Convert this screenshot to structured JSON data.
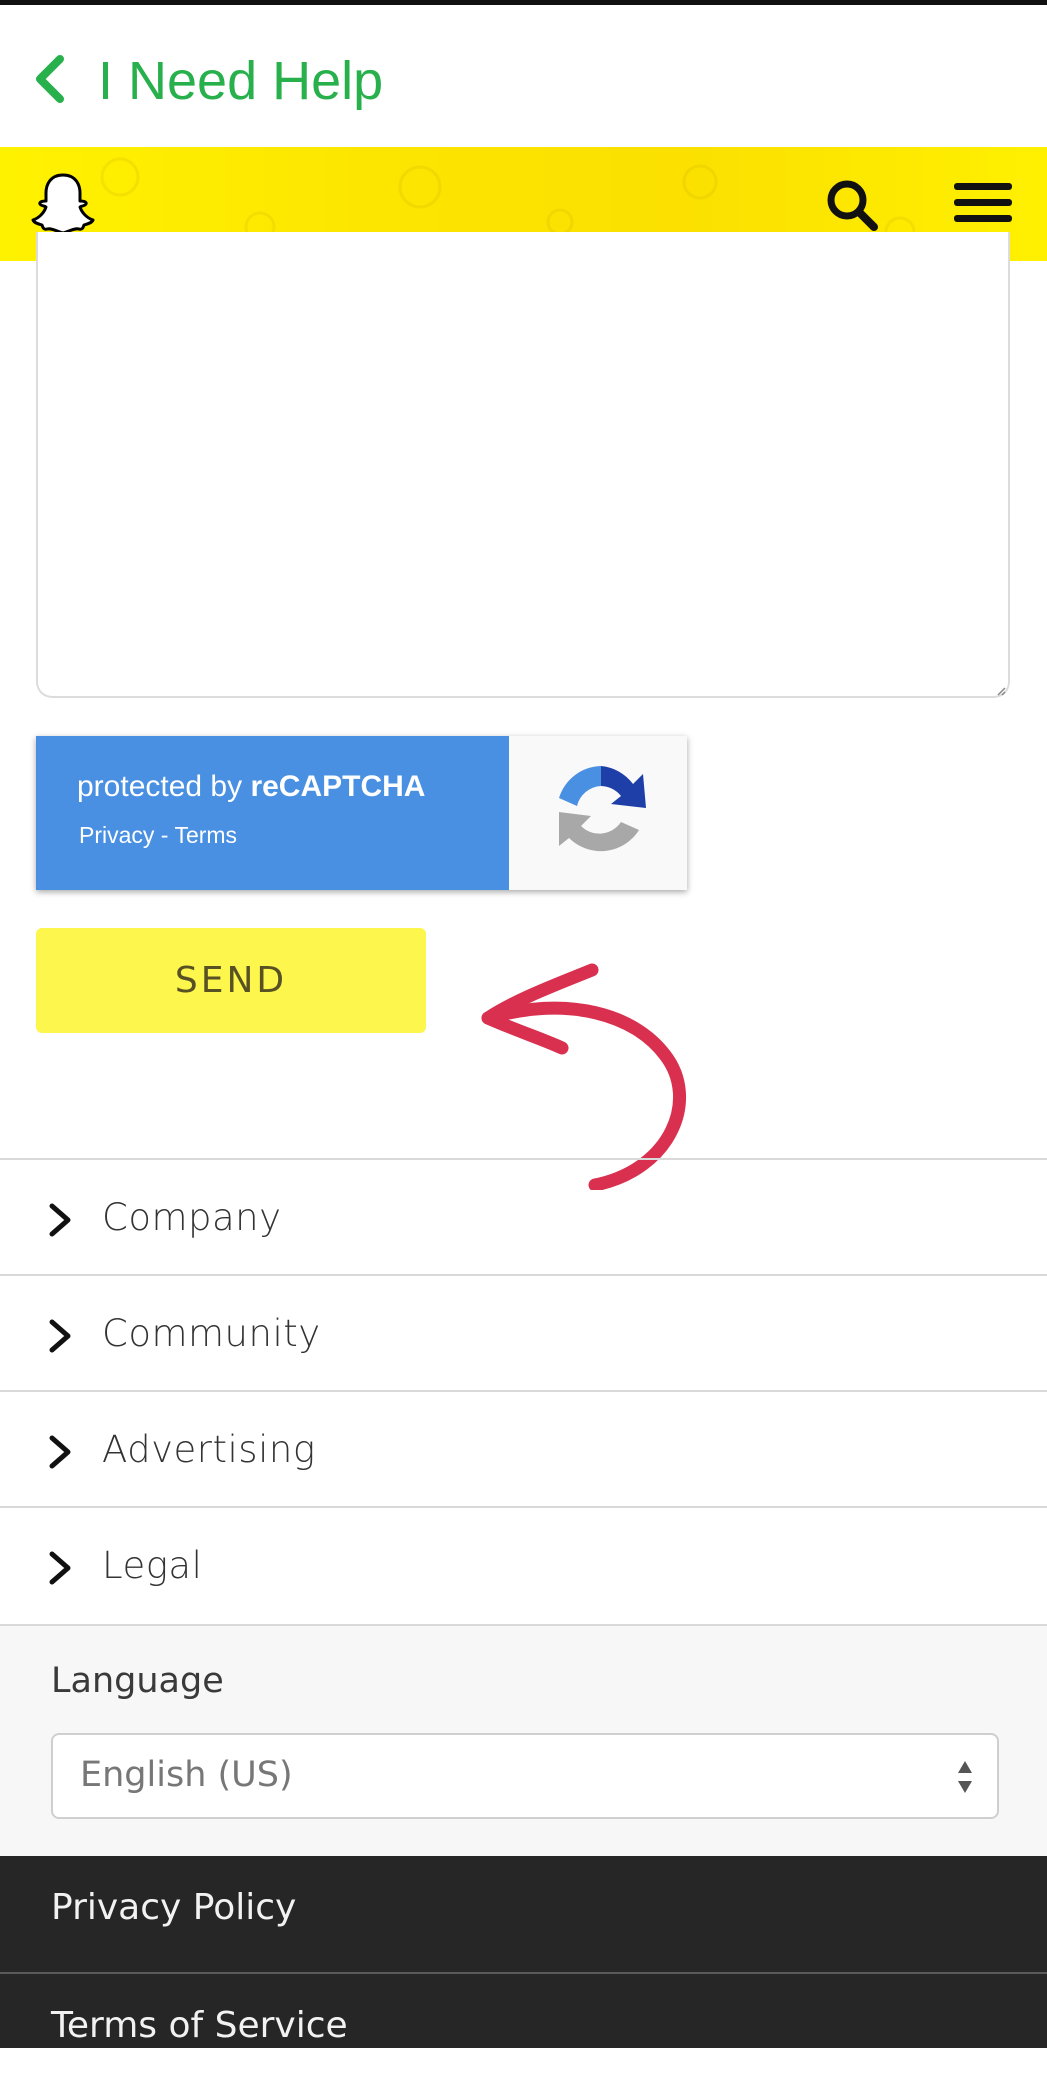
{
  "header": {
    "title": "I Need Help",
    "back_icon": "chevron-left-icon",
    "accent_color": "#27b04b"
  },
  "snap_bar": {
    "logo_icon": "snapchat-ghost-icon",
    "search_icon": "search-icon",
    "menu_icon": "hamburger-menu-icon",
    "background_color": "#fce600"
  },
  "message_box": {
    "value": ""
  },
  "recaptcha": {
    "protected_by": "protected by ",
    "brand": "reCAPTCHA",
    "privacy": "Privacy",
    "separator": " - ",
    "terms": "Terms",
    "color": "#4a90e2"
  },
  "form": {
    "send_label": "SEND",
    "send_color": "#fdf64c"
  },
  "annotation": {
    "arrow_color": "#d9304f"
  },
  "footer_nav": {
    "items": [
      {
        "label": "Company"
      },
      {
        "label": "Community"
      },
      {
        "label": "Advertising"
      },
      {
        "label": "Legal"
      }
    ]
  },
  "language": {
    "label": "Language",
    "selected": "English (US)"
  },
  "bottom_links": {
    "privacy_policy": "Privacy Policy",
    "terms_of_service": "Terms of Service"
  }
}
